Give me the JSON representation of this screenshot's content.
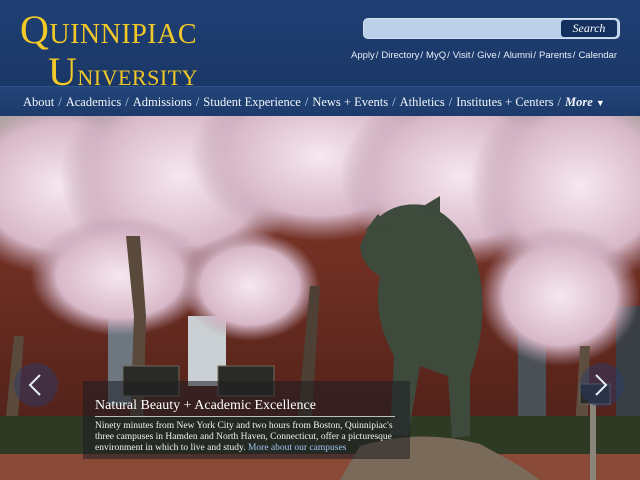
{
  "logo": {
    "line1": "QUINNIPIAC",
    "line2": "UNIVERSITY"
  },
  "search": {
    "value": "",
    "button_label": "Search"
  },
  "utility_links": [
    "Apply",
    "Directory",
    "MyQ",
    "Visit",
    "Give",
    "Alumni",
    "Parents",
    "Calendar"
  ],
  "nav": {
    "items": [
      "About",
      "Academics",
      "Admissions",
      "Student Experience",
      "News + Events",
      "Athletics",
      "Institutes + Centers"
    ],
    "more_label": "More",
    "more_icon": "caret-down-icon"
  },
  "hero": {
    "title": "Natural Beauty + Academic Excellence",
    "description": "Ninety minutes from New York City and two hours from Boston, Quinnipiac's three campuses in Hamden and North Haven, Connecticut, offer a picturesque environment in which to live and study.",
    "link": "More about our campuses",
    "prev_icon": "chevron-left-icon",
    "next_icon": "chevron-right-icon"
  },
  "colors": {
    "header_bg": "#1f3f74",
    "logo_gold": "#f2c927",
    "search_bg": "#bcd0ea",
    "search_button": "#13305e",
    "link_blue": "#9fc4f2"
  }
}
